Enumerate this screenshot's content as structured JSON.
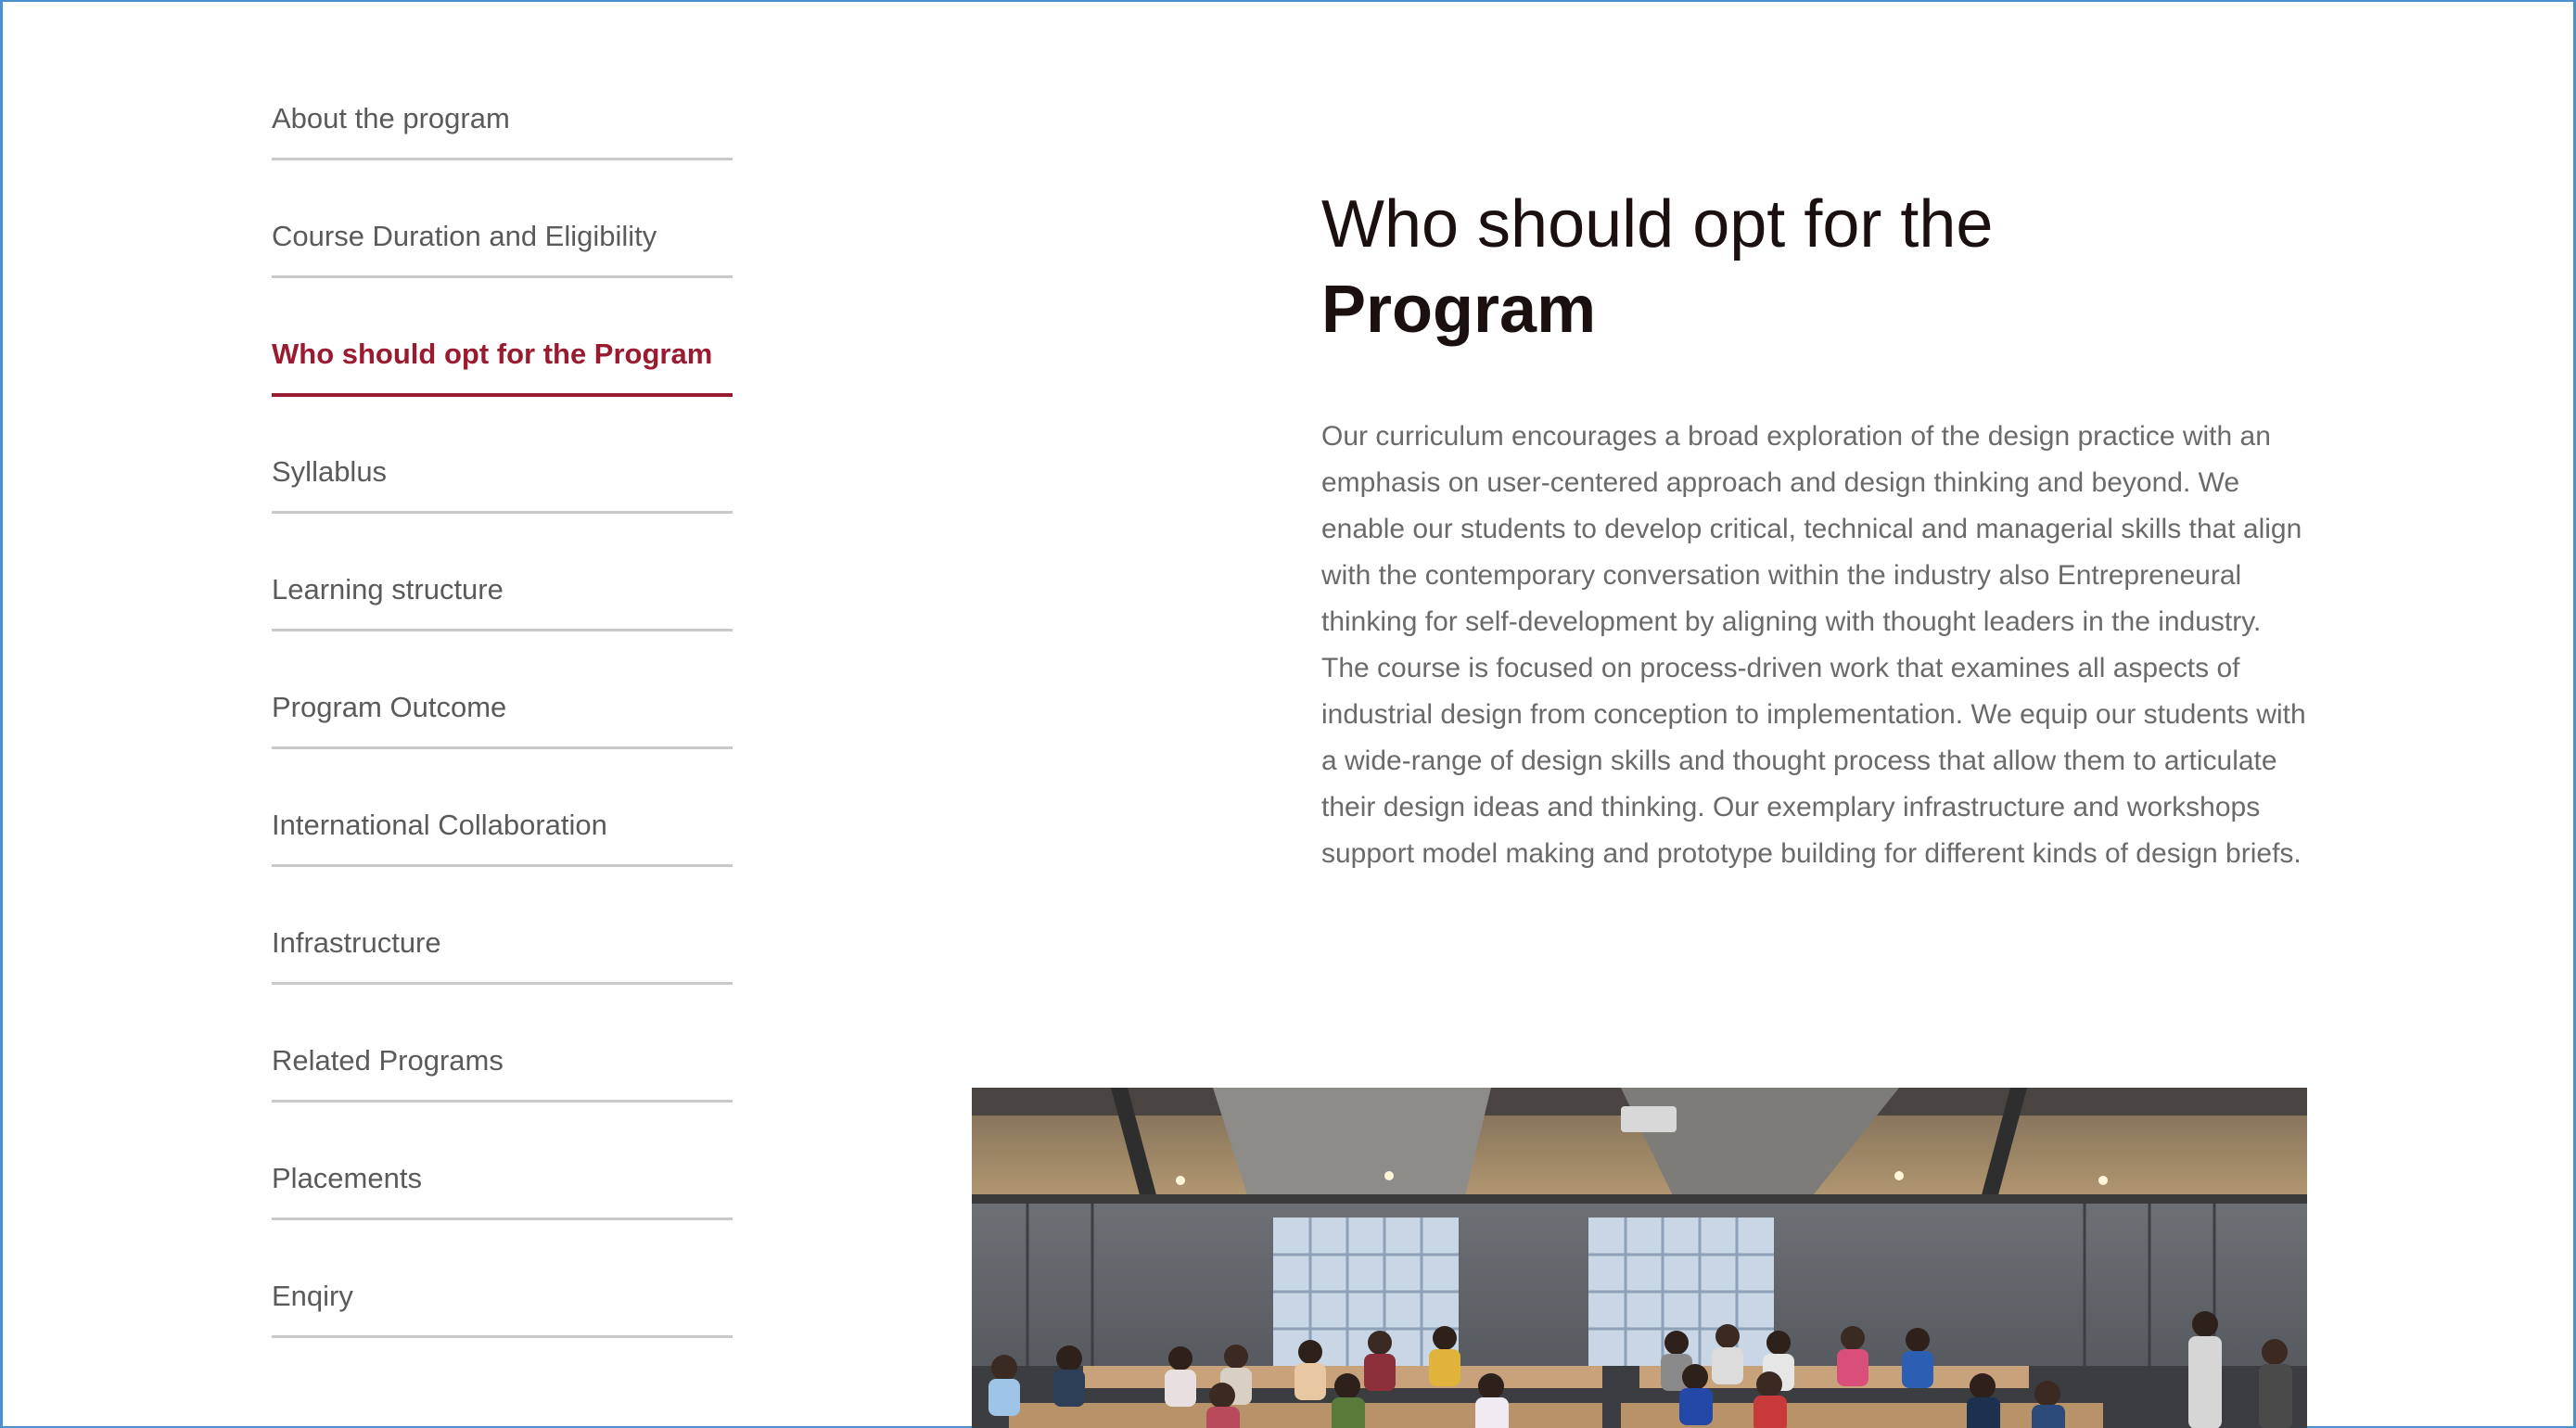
{
  "sidebar": {
    "items": [
      {
        "label": "About the program",
        "active": false
      },
      {
        "label": "Course Duration and Eligibility",
        "active": false
      },
      {
        "label": "Who should opt for the Program",
        "active": true
      },
      {
        "label": "Syllablus",
        "active": false
      },
      {
        "label": "Learning structure",
        "active": false
      },
      {
        "label": "Program Outcome",
        "active": false
      },
      {
        "label": "International Collaboration",
        "active": false
      },
      {
        "label": "Infrastructure",
        "active": false
      },
      {
        "label": "Related Programs",
        "active": false
      },
      {
        "label": "Placements",
        "active": false
      },
      {
        "label": "Enqiry",
        "active": false
      }
    ]
  },
  "main": {
    "heading_line1": "Who should opt for the",
    "heading_line2": "Program",
    "body": "Our curriculum encourages a broad exploration of the design practice with an emphasis on user-centered approach and design thinking and beyond. We enable our students to develop critical, technical and managerial skills that align with the contemporary conversation within the industry also Entrepreneural thinking for self-development by aligning with thought leaders in the industry. The course is focused on process-driven work that examines all aspects of industrial design from conception to implementation. We equip our students with a wide-range of design skills and thought process that allow them to articulate their design ideas and thinking.  Our exemplary infrastructure and workshops support model making and prototype building for different kinds of design briefs."
  },
  "colors": {
    "accent": "#9a1b2f",
    "nav_text": "#5a5a5a",
    "divider": "#c9c9c9",
    "body_text": "#6a6a6a",
    "heading_text": "#1a1010"
  }
}
